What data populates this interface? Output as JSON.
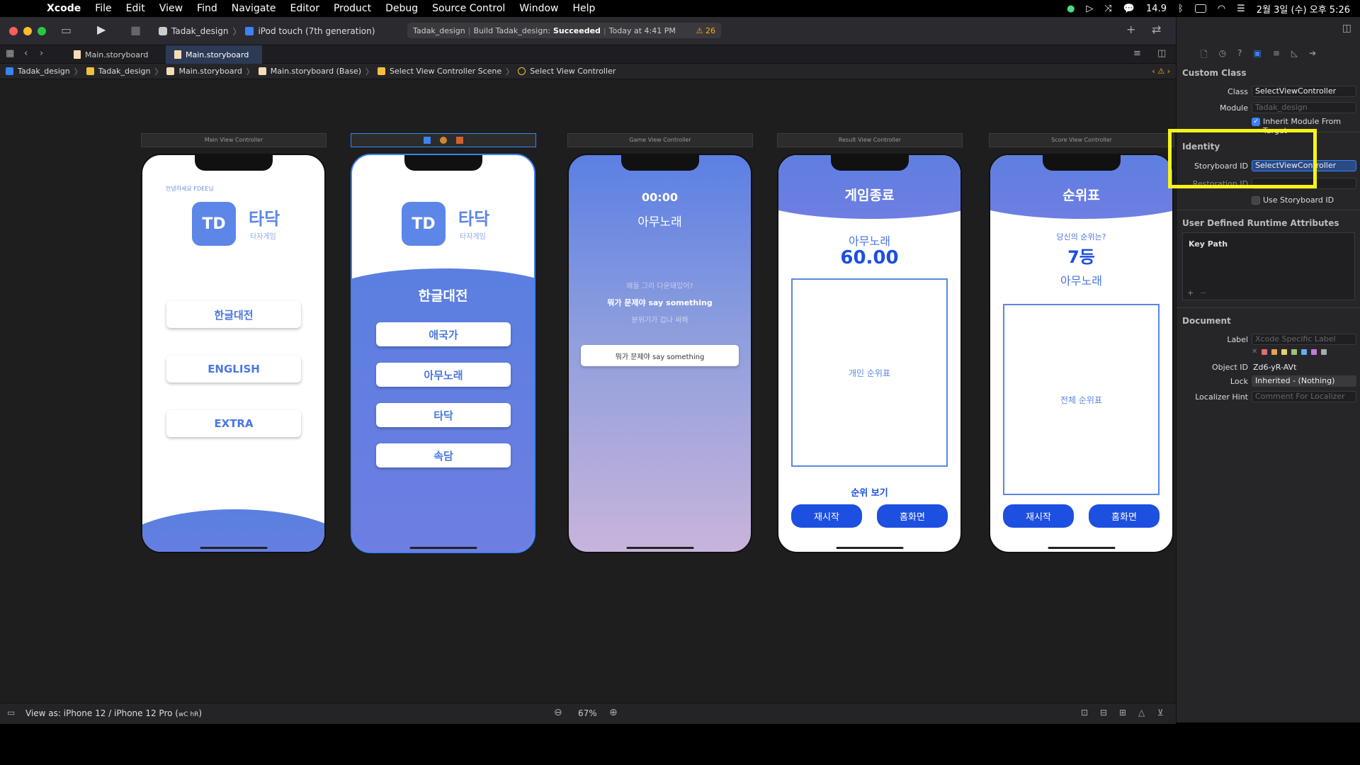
{
  "menubar": {
    "app": "Xcode",
    "items": [
      "File",
      "Edit",
      "View",
      "Find",
      "Navigate",
      "Editor",
      "Product",
      "Debug",
      "Source Control",
      "Window",
      "Help"
    ],
    "battery_text": "14.9",
    "clock": "2월 3일 (수) 오후 5:26"
  },
  "toolbar": {
    "scheme": "Tadak_design",
    "device": "iPod touch (7th generation)",
    "activity_project": "Tadak_design",
    "activity_build": "Build Tadak_design:",
    "activity_status": "Succeeded",
    "activity_time": "Today at 4:41 PM",
    "warnings": "26"
  },
  "tabs": [
    {
      "label": "Main.storyboard"
    },
    {
      "label": "Main.storyboard"
    }
  ],
  "jumpbar": [
    "Tadak_design",
    "Tadak_design",
    "Main.storyboard",
    "Main.storyboard (Base)",
    "Select View Controller Scene",
    "Select View Controller"
  ],
  "scenes": {
    "main": {
      "title": "Main View Controller",
      "greeting": "안녕하세요 FDEE님",
      "logo": "TD",
      "app_name": "타닥",
      "app_sub": "타자게임",
      "buttons": [
        "한글대전",
        "ENGLISH",
        "EXTRA"
      ]
    },
    "select": {
      "logo": "TD",
      "app_name": "타닥",
      "app_sub": "타자게임",
      "heading": "한글대전",
      "buttons": [
        "애국가",
        "아무노래",
        "타닥",
        "속담"
      ]
    },
    "game": {
      "title": "Game View Controller",
      "timer": "00:00",
      "song": "아무노래",
      "prev_line": "왜들 그리 다운돼있어?",
      "current_line": "뭐가 문제야 say something",
      "next_line": "분위기가 겁나 싸해",
      "input_value": "뭐가 문제야 say something"
    },
    "result": {
      "title": "Result View Controller",
      "header": "게임종료",
      "song": "아무노래",
      "score": "60.00",
      "box_label": "개인 순위표",
      "rank_link": "순위 보기",
      "btn_restart": "재시작",
      "btn_home": "홈화면"
    },
    "score": {
      "title": "Score View Controller",
      "header": "순위표",
      "question": "당신의 순위는?",
      "rank": "7등",
      "song": "아무노래",
      "box_label": "전체 순위표",
      "btn_restart": "재시작",
      "btn_home": "홈화면"
    }
  },
  "inspector": {
    "custom_class_title": "Custom Class",
    "class_label": "Class",
    "class_value": "SelectViewController",
    "module_label": "Module",
    "module_placeholder": "Tadak_design",
    "inherit_label": "Inherit Module From Target",
    "identity_title": "Identity",
    "storyboard_id_label": "Storyboard ID",
    "storyboard_id_value": "SelectViewController",
    "restoration_id_label": "Restoration ID",
    "use_storyboard_id_label": "Use Storyboard ID",
    "udra_title": "User Defined Runtime Attributes",
    "key_path_header": "Key Path",
    "document_title": "Document",
    "doc_label_label": "Label",
    "doc_label_placeholder": "Xcode Specific Label",
    "object_id_label": "Object ID",
    "object_id_value": "Zd6-yR-AVt",
    "lock_label": "Lock",
    "lock_value": "Inherited - (Nothing)",
    "localizer_label": "Localizer Hint",
    "localizer_placeholder": "Comment For Localizer",
    "label_colors": [
      "#e06c75",
      "#e5a050",
      "#e5d070",
      "#98c379",
      "#61afef",
      "#c678dd",
      "#aaaaaa"
    ]
  },
  "bottombar": {
    "view_as": "View as: iPhone 12 / iPhone 12 Pro (",
    "view_as_keys": "wC hR",
    "view_as_close": ")",
    "zoom": "67%"
  }
}
